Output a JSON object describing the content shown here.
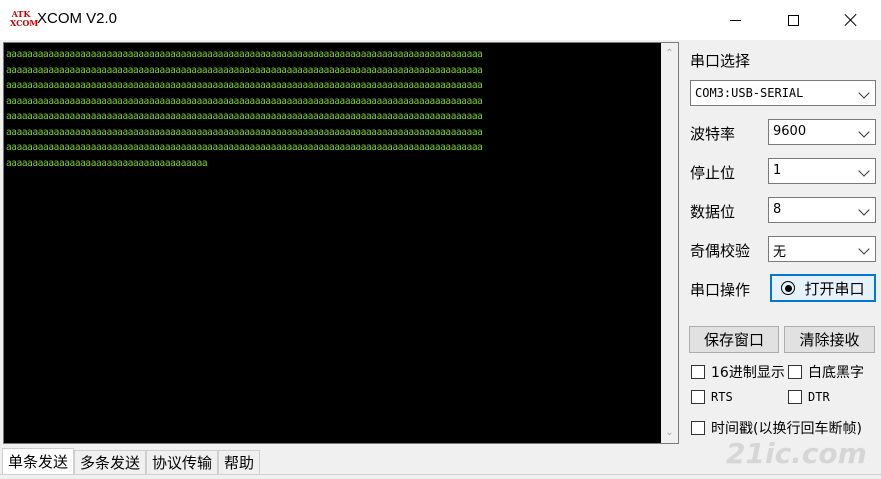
{
  "window": {
    "title": "XCOM V2.0",
    "logo_text": "ATK XCOM"
  },
  "terminal": {
    "lines": [
      "aaaaaaaaaaaaaaaaaaaaaaaaaaaaaaaaaaaaaaaaaaaaaaaaaaaaaaaaaaaaaaaaaaaaaaaaaaaaaaaaaaaaaaaaaa",
      "aaaaaaaaaaaaaaaaaaaaaaaaaaaaaaaaaaaaaaaaaaaaaaaaaaaaaaaaaaaaaaaaaaaaaaaaaaaaaaaaaaaaaaaaaa",
      "aaaaaaaaaaaaaaaaaaaaaaaaaaaaaaaaaaaaaaaaaaaaaaaaaaaaaaaaaaaaaaaaaaaaaaaaaaaaaaaaaaaaaaaaaa",
      "aaaaaaaaaaaaaaaaaaaaaaaaaaaaaaaaaaaaaaaaaaaaaaaaaaaaaaaaaaaaaaaaaaaaaaaaaaaaaaaaaaaaaaaaaa",
      "aaaaaaaaaaaaaaaaaaaaaaaaaaaaaaaaaaaaaaaaaaaaaaaaaaaaaaaaaaaaaaaaaaaaaaaaaaaaaaaaaaaaaaaaaa",
      "aaaaaaaaaaaaaaaaaaaaaaaaaaaaaaaaaaaaaaaaaaaaaaaaaaaaaaaaaaaaaaaaaaaaaaaaaaaaaaaaaaaaaaaaaa",
      "aaaaaaaaaaaaaaaaaaaaaaaaaaaaaaaaaaaaaaaaaaaaaaaaaaaaaaaaaaaaaaaaaaaaaaaaaaaaaaaaaaaaaaaaaa",
      "aaaaaaaaaaaaaaaaaaaaaaaaaaaaaaaaaaaaaa"
    ],
    "text_color": "#7fd12c",
    "background": "#000000"
  },
  "panel": {
    "port_select_label": "串口选择",
    "port_value": "COM3:USB-SERIAL",
    "baud_label": "波特率",
    "baud_value": "9600",
    "stop_label": "停止位",
    "stop_value": "1",
    "data_label": "数据位",
    "data_value": "8",
    "parity_label": "奇偶校验",
    "parity_value": "无",
    "op_label": "串口操作",
    "open_button": "打开串口",
    "save_button": "保存窗口",
    "clear_button": "清除接收",
    "hex_display": "16进制显示",
    "white_bg": "白底黑字",
    "rts": "RTS",
    "dtr": "DTR",
    "timestamp": "时间戳(以换行回车断帧)"
  },
  "tabs": [
    "单条发送",
    "多条发送",
    "协议传输",
    "帮助"
  ],
  "watermark": "21ic.com",
  "colors": {
    "accent": "#0078d7",
    "logo": "#cc0000"
  }
}
